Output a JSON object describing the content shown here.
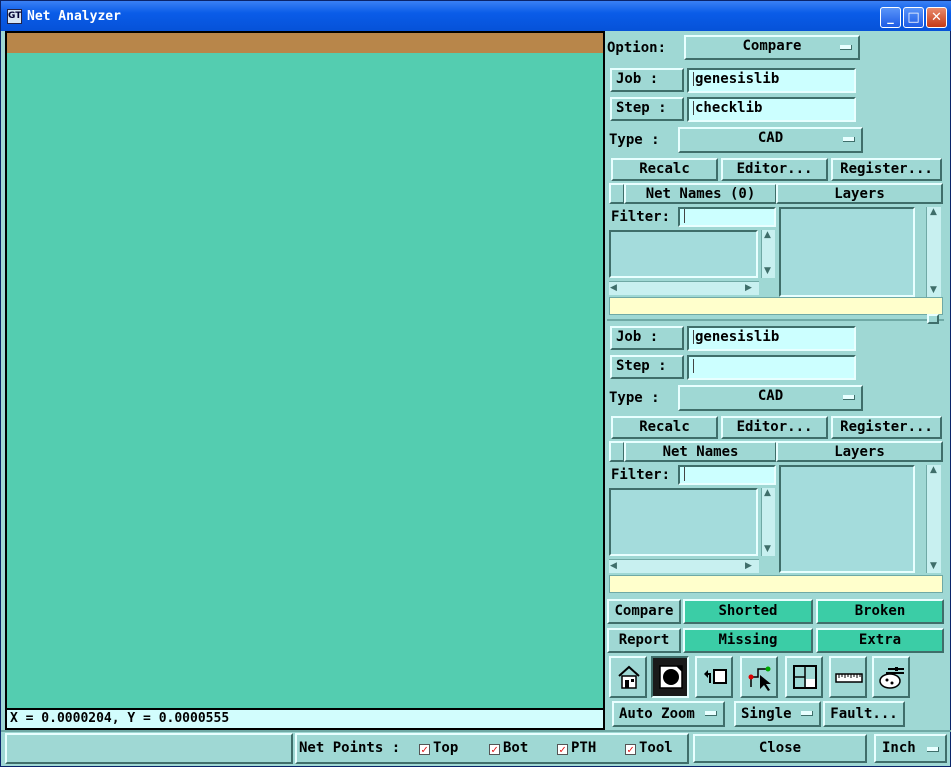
{
  "window": {
    "title": "Net Analyzer",
    "icon": "app-icon"
  },
  "titlebar_buttons": {
    "minimize": "_",
    "maximize": "□",
    "close": "✕"
  },
  "canvas": {
    "coord_readout": "X = 0.0000204, Y = 0.0000555"
  },
  "option": {
    "label": "Option:",
    "value": "Compare"
  },
  "top": {
    "job_label": "Job  :",
    "job_value": "genesislib",
    "step_label": "Step :",
    "step_value": "checklib",
    "type_label": "Type :",
    "type_value": "CAD",
    "recalc": "Recalc",
    "editor": "Editor...",
    "register": "Register...",
    "net_names_header": "Net Names (0)",
    "layers_header": "Layers",
    "filter_label": "Filter:"
  },
  "bottom": {
    "job_label": "Job  :",
    "job_value": "genesislib",
    "step_label": "Step :",
    "step_value": "",
    "type_label": "Type :",
    "type_value": "CAD",
    "recalc": "Recalc",
    "editor": "Editor...",
    "register": "Register...",
    "net_names_header": "Net Names",
    "layers_header": "Layers",
    "filter_label": "Filter:"
  },
  "results": {
    "compare": "Compare",
    "shorted": "Shorted",
    "broken": "Broken",
    "report": "Report",
    "missing": "Missing",
    "extra": "Extra"
  },
  "toolbar_icons": [
    "home-icon",
    "zoom-fit-icon",
    "undo-view-icon",
    "select-pointer-icon",
    "window-xy-icon",
    "ruler-icon",
    "palette-settings-icon"
  ],
  "controls": {
    "auto_zoom": "Auto Zoom",
    "single": "Single",
    "fault": "Fault..."
  },
  "status": {
    "net_points_label": "Net Points :",
    "top": "Top",
    "bot": "Bot",
    "pth": "PTH",
    "tool": "Tool",
    "close": "Close",
    "units": "Inch"
  },
  "colors": {
    "panel": "#9fd8d4",
    "canvas": "#54cdb0",
    "canvas_header": "#b8864a",
    "accent_button": "#3bcda6",
    "input": "#ccffff",
    "status_bar": "#ffffcc"
  }
}
